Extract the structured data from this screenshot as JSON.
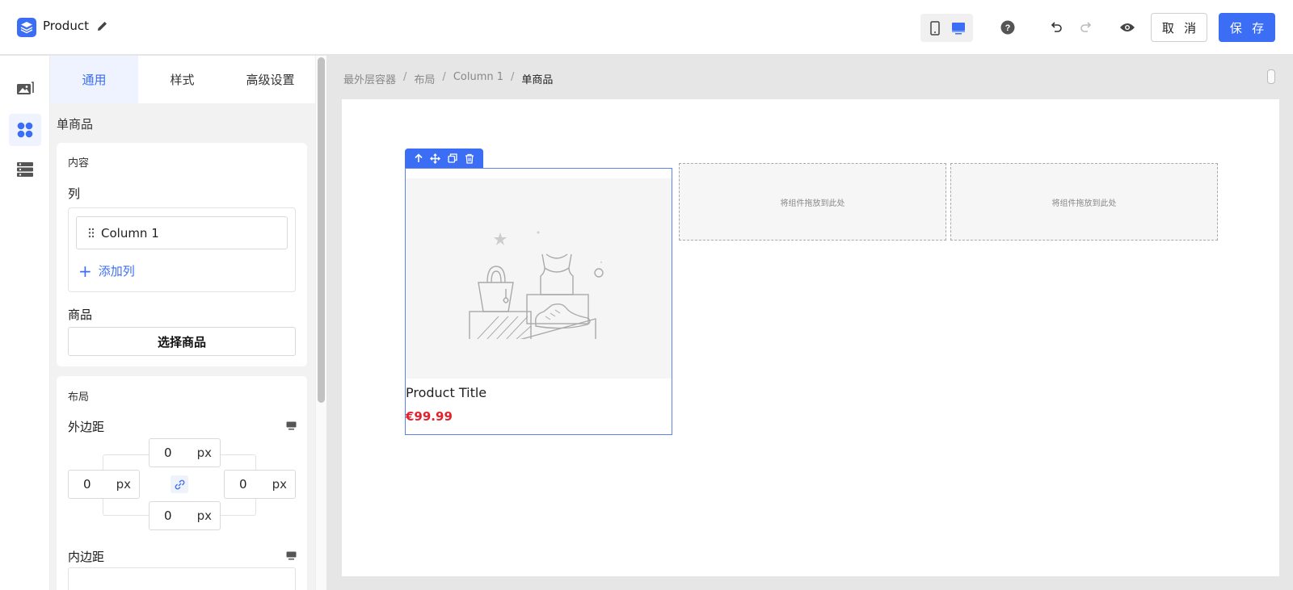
{
  "header": {
    "title": "Product",
    "cancel_label": "取 消",
    "save_label": "保 存"
  },
  "panel": {
    "tabs": [
      {
        "label": "通用",
        "active": true
      },
      {
        "label": "样式",
        "active": false
      },
      {
        "label": "高级设置",
        "active": false
      }
    ],
    "section_title": "单商品",
    "content": {
      "label": "内容",
      "columns_label": "列",
      "columns": [
        {
          "label": "Column 1"
        }
      ],
      "add_column_label": "添加列",
      "product_label": "商品",
      "select_product_label": "选择商品"
    },
    "layout": {
      "label": "布局",
      "margin_label": "外边距",
      "margin": {
        "top": "0",
        "left": "0",
        "right": "0",
        "bottom": "0",
        "unit": "px"
      },
      "padding_label": "内边距"
    }
  },
  "canvas": {
    "breadcrumb": [
      "最外层容器",
      "布局",
      "Column 1",
      "单商品"
    ],
    "product": {
      "title": "Product Title",
      "price": "€99.99"
    },
    "dropzone_text": "将组件拖放到此处"
  },
  "colors": {
    "accent": "#3b6ef5",
    "price": "#e5212d"
  }
}
